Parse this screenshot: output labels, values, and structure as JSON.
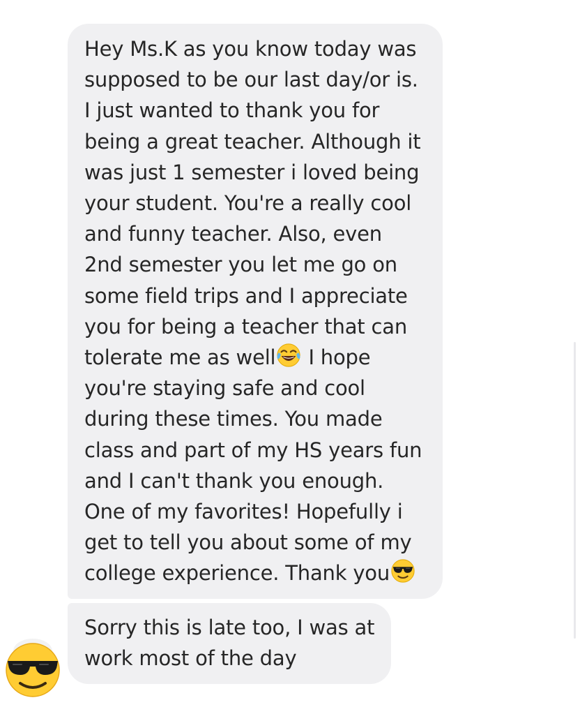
{
  "conversation": {
    "messages": [
      {
        "lines": [
          "Hey Ms.K as you know today was",
          "supposed to be our last day/or is.",
          "I just wanted to thank you for",
          "being a great teacher. Although it",
          "was just 1 semester i loved being",
          "your student. You're a really cool",
          "and funny teacher. Also, even",
          "2nd semester you let me go on",
          "some field trips and I appreciate",
          "you for being a teacher that can",
          "tolerate me as well",
          "you're staying safe and cool",
          "during these times. You made",
          "class and part of my HS years fun",
          "and I can't thank you enough.",
          "One of my favorites! Hopefully i",
          "get to tell you about some of my",
          "college experience. Thank you"
        ],
        "line_11_suffix": " I hope",
        "emojis": [
          "laughing-tears-emoji",
          "sunglasses-emoji"
        ]
      },
      {
        "lines": [
          "Sorry this is late too, I was at",
          "work most of the day"
        ]
      }
    ],
    "avatar": {
      "icon": "sunglasses-face-icon"
    }
  },
  "colors": {
    "bubble": "#f0f0f2",
    "text": "#262626",
    "emoji_yellow": "#ffcc33",
    "emoji_dark": "#1a1a1a"
  }
}
